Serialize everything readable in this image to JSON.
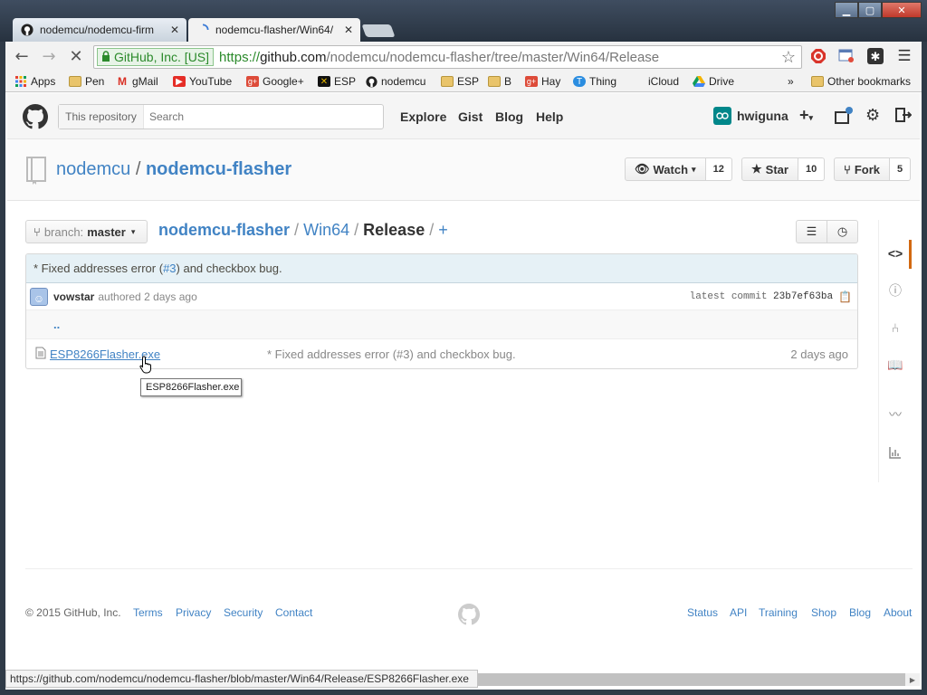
{
  "browser": {
    "tabs": [
      {
        "title": "nodemcu/nodemcu-firm",
        "icon": "github-icon"
      },
      {
        "title": "nodemcu-flasher/Win64/",
        "icon": "loading-spinner-icon"
      }
    ],
    "ev_label": "GitHub, Inc. [US]",
    "url": {
      "scheme": "https://",
      "host": "github.com",
      "path": "/nodemcu/nodemcu-flasher/tree/master/Win64/Release"
    },
    "bookmarks": [
      {
        "label": "Apps",
        "icon": "apps-grid-icon"
      },
      {
        "label": "Pen",
        "icon": "folder-icon"
      },
      {
        "label": "gMail",
        "icon": "gmail-icon"
      },
      {
        "label": "YouTube",
        "icon": "youtube-icon"
      },
      {
        "label": "Google+",
        "icon": "googleplus-icon"
      },
      {
        "label": "ESP",
        "icon": "esp-icon"
      },
      {
        "label": "nodemcu",
        "icon": "github-icon"
      },
      {
        "label": "ESP",
        "icon": "folder-icon"
      },
      {
        "label": "B",
        "icon": "folder-icon"
      },
      {
        "label": "Hay",
        "icon": "googleplus-icon"
      },
      {
        "label": "Thing",
        "icon": "thing-icon"
      },
      {
        "label": "iCloud",
        "icon": "apple-icon"
      },
      {
        "label": "Drive",
        "icon": "drive-icon"
      }
    ],
    "overflow": "»",
    "other_bookmarks": "Other bookmarks",
    "status_url": "https://github.com/nodemcu/nodemcu-flasher/blob/master/Win64/Release/ESP8266Flasher.exe"
  },
  "github": {
    "search": {
      "scope": "This repository",
      "placeholder": "Search"
    },
    "nav": [
      "Explore",
      "Gist",
      "Blog",
      "Help"
    ],
    "user": "hwiguna",
    "repo": {
      "owner": "nodemcu",
      "sep": " / ",
      "name": "nodemcu-flasher"
    },
    "actions": {
      "watch": "Watch",
      "watch_count": "12",
      "star": "Star",
      "star_count": "10",
      "fork": "Fork",
      "fork_count": "5"
    },
    "branch": {
      "prefix": "branch:",
      "name": "master"
    },
    "breadcrumb": {
      "root": "nodemcu-flasher",
      "dir": "Win64",
      "current": "Release",
      "sep": "/",
      "add": "+"
    },
    "commit": {
      "message_prefix": "* Fixed addresses error (",
      "issue": "#3",
      "message_suffix": ") and checkbox bug.",
      "author": "vowstar",
      "authored": "authored 2 days ago",
      "latest_label": "latest commit ",
      "sha": "23b7ef63ba"
    },
    "files": {
      "updir": "..",
      "name": "ESP8266Flasher.exe",
      "message": "* Fixed addresses error (#3) and checkbox bug.",
      "age": "2 days ago"
    },
    "tooltip": "ESP8266Flasher.exe",
    "footer": {
      "copyright": "© 2015 GitHub, Inc.",
      "left_links": [
        "Terms",
        "Privacy",
        "Security",
        "Contact"
      ],
      "right_links": [
        "Status",
        "API",
        "Training",
        "Shop",
        "Blog",
        "About"
      ]
    }
  }
}
